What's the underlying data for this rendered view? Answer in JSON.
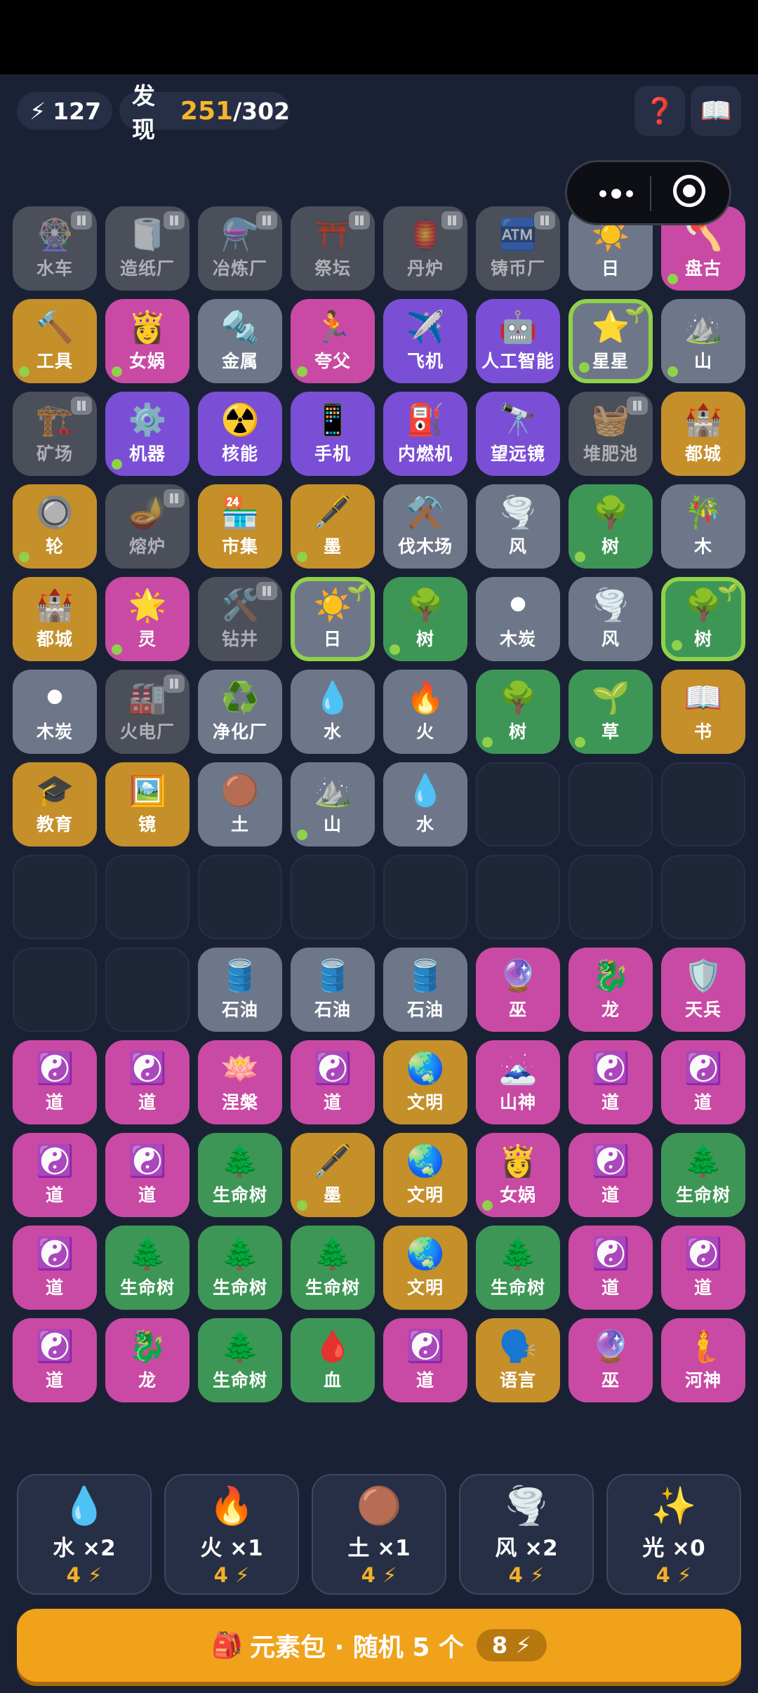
{
  "header": {
    "energy_icon": "⚡",
    "energy_value": "127",
    "discover_label": "发现",
    "discovered": "251",
    "total": "/302",
    "help_icon": "❓",
    "book_icon": "📖"
  },
  "colors": {
    "gray": "#6e7789",
    "gold": "#c58f2a",
    "pink": "#c94aa4",
    "purple": "#7a4fd5",
    "green": "#3e9656",
    "locked": "#4b4f59",
    "highlight": "#8fd14a",
    "accent": "#f7b52b"
  },
  "grid": [
    [
      {
        "e": "🎡",
        "n": "水车",
        "c": "locked"
      },
      {
        "e": "🧻",
        "n": "造纸厂",
        "c": "locked"
      },
      {
        "e": "⚗️",
        "n": "冶炼厂",
        "c": "locked"
      },
      {
        "e": "⛩️",
        "n": "祭坛",
        "c": "locked"
      },
      {
        "e": "🏮",
        "n": "丹炉",
        "c": "locked"
      },
      {
        "e": "🏧",
        "n": "铸币厂",
        "c": "locked"
      },
      {
        "e": "☀️",
        "n": "日",
        "c": "gray"
      },
      {
        "e": "🪓",
        "n": "盘古",
        "c": "pink",
        "dot": true
      }
    ],
    [
      {
        "e": "🔨",
        "n": "工具",
        "c": "gold",
        "dot": true
      },
      {
        "e": "👸",
        "n": "女娲",
        "c": "pink",
        "dot": true
      },
      {
        "e": "🔩",
        "n": "金属",
        "c": "gray"
      },
      {
        "e": "🏃",
        "n": "夸父",
        "c": "pink",
        "dot": true
      },
      {
        "e": "✈️",
        "n": "飞机",
        "c": "purple"
      },
      {
        "e": "🤖",
        "n": "人工智能",
        "c": "purple"
      },
      {
        "e": "⭐",
        "n": "星星",
        "c": "gray",
        "hl": true,
        "dot": true
      },
      {
        "e": "⛰️",
        "n": "山",
        "c": "gray",
        "dot": true
      }
    ],
    [
      {
        "e": "🏗️",
        "n": "矿场",
        "c": "locked"
      },
      {
        "e": "⚙️",
        "n": "机器",
        "c": "purple",
        "dot": true
      },
      {
        "e": "☢️",
        "n": "核能",
        "c": "purple"
      },
      {
        "e": "📱",
        "n": "手机",
        "c": "purple"
      },
      {
        "e": "⛽",
        "n": "内燃机",
        "c": "purple"
      },
      {
        "e": "🔭",
        "n": "望远镜",
        "c": "purple"
      },
      {
        "e": "🧺",
        "n": "堆肥池",
        "c": "locked"
      },
      {
        "e": "🏰",
        "n": "都城",
        "c": "gold"
      }
    ],
    [
      {
        "e": "🔘",
        "n": "轮",
        "c": "gold",
        "dot": true
      },
      {
        "e": "🪔",
        "n": "熔炉",
        "c": "locked"
      },
      {
        "e": "🏪",
        "n": "市集",
        "c": "gold"
      },
      {
        "e": "🖋️",
        "n": "墨",
        "c": "gold",
        "dot": true
      },
      {
        "e": "⚒️",
        "n": "伐木场",
        "c": "gray"
      },
      {
        "e": "🌪️",
        "n": "风",
        "c": "gray"
      },
      {
        "e": "🌳",
        "n": "树",
        "c": "green",
        "dot": true
      },
      {
        "e": "🎋",
        "n": "木",
        "c": "gray"
      }
    ],
    [
      {
        "e": "🏰",
        "n": "都城",
        "c": "gold"
      },
      {
        "e": "🌟",
        "n": "灵",
        "c": "pink",
        "dot": true
      },
      {
        "e": "🛠️",
        "n": "钻井",
        "c": "locked"
      },
      {
        "e": "☀️",
        "n": "日",
        "c": "gray",
        "hl": true
      },
      {
        "e": "🌳",
        "n": "树",
        "c": "green",
        "dot": true
      },
      {
        "e": "⚫",
        "n": "木炭",
        "c": "gray"
      },
      {
        "e": "🌪️",
        "n": "风",
        "c": "gray"
      },
      {
        "e": "🌳",
        "n": "树",
        "c": "green",
        "hl": true,
        "dot": true
      }
    ],
    [
      {
        "e": "⚫",
        "n": "木炭",
        "c": "gray"
      },
      {
        "e": "🏭",
        "n": "火电厂",
        "c": "locked"
      },
      {
        "e": "♻️",
        "n": "净化厂",
        "c": "gray"
      },
      {
        "e": "💧",
        "n": "水",
        "c": "gray"
      },
      {
        "e": "🔥",
        "n": "火",
        "c": "gray"
      },
      {
        "e": "🌳",
        "n": "树",
        "c": "green",
        "dot": true
      },
      {
        "e": "🌱",
        "n": "草",
        "c": "green",
        "dot": true
      },
      {
        "e": "📖",
        "n": "书",
        "c": "gold"
      }
    ],
    [
      {
        "e": "🎓",
        "n": "教育",
        "c": "gold"
      },
      {
        "e": "🖼️",
        "n": "镜",
        "c": "gold"
      },
      {
        "e": "🟤",
        "n": "土",
        "c": "gray"
      },
      {
        "e": "⛰️",
        "n": "山",
        "c": "gray",
        "dot": true
      },
      {
        "e": "💧",
        "n": "水",
        "c": "gray"
      },
      {
        "c": "empty"
      },
      {
        "c": "empty"
      },
      {
        "c": "empty"
      }
    ],
    [
      {
        "c": "empty"
      },
      {
        "c": "empty"
      },
      {
        "c": "empty"
      },
      {
        "c": "empty"
      },
      {
        "c": "empty"
      },
      {
        "c": "empty"
      },
      {
        "c": "empty"
      },
      {
        "c": "empty"
      }
    ],
    [
      {
        "c": "empty"
      },
      {
        "c": "empty"
      },
      {
        "e": "🛢️",
        "n": "石油",
        "c": "gray"
      },
      {
        "e": "🛢️",
        "n": "石油",
        "c": "gray"
      },
      {
        "e": "🛢️",
        "n": "石油",
        "c": "gray"
      },
      {
        "e": "🔮",
        "n": "巫",
        "c": "pink"
      },
      {
        "e": "🐉",
        "n": "龙",
        "c": "pink"
      },
      {
        "e": "🛡️",
        "n": "天兵",
        "c": "pink"
      }
    ],
    [
      {
        "e": "☯️",
        "n": "道",
        "c": "pink"
      },
      {
        "e": "☯️",
        "n": "道",
        "c": "pink"
      },
      {
        "e": "🪷",
        "n": "涅槃",
        "c": "pink"
      },
      {
        "e": "☯️",
        "n": "道",
        "c": "pink"
      },
      {
        "e": "🌏",
        "n": "文明",
        "c": "gold"
      },
      {
        "e": "🗻",
        "n": "山神",
        "c": "pink"
      },
      {
        "e": "☯️",
        "n": "道",
        "c": "pink"
      },
      {
        "e": "☯️",
        "n": "道",
        "c": "pink"
      }
    ],
    [
      {
        "e": "☯️",
        "n": "道",
        "c": "pink"
      },
      {
        "e": "☯️",
        "n": "道",
        "c": "pink"
      },
      {
        "e": "🌲",
        "n": "生命树",
        "c": "green"
      },
      {
        "e": "🖋️",
        "n": "墨",
        "c": "gold",
        "dot": true
      },
      {
        "e": "🌏",
        "n": "文明",
        "c": "gold"
      },
      {
        "e": "👸",
        "n": "女娲",
        "c": "pink",
        "dot": true
      },
      {
        "e": "☯️",
        "n": "道",
        "c": "pink"
      },
      {
        "e": "🌲",
        "n": "生命树",
        "c": "green"
      }
    ],
    [
      {
        "e": "☯️",
        "n": "道",
        "c": "pink"
      },
      {
        "e": "🌲",
        "n": "生命树",
        "c": "green"
      },
      {
        "e": "🌲",
        "n": "生命树",
        "c": "green"
      },
      {
        "e": "🌲",
        "n": "生命树",
        "c": "green"
      },
      {
        "e": "🌏",
        "n": "文明",
        "c": "gold"
      },
      {
        "e": "🌲",
        "n": "生命树",
        "c": "green"
      },
      {
        "e": "☯️",
        "n": "道",
        "c": "pink"
      },
      {
        "e": "☯️",
        "n": "道",
        "c": "pink"
      }
    ],
    [
      {
        "e": "☯️",
        "n": "道",
        "c": "pink"
      },
      {
        "e": "🐉",
        "n": "龙",
        "c": "pink"
      },
      {
        "e": "🌲",
        "n": "生命树",
        "c": "green"
      },
      {
        "e": "🩸",
        "n": "血",
        "c": "green"
      },
      {
        "e": "☯️",
        "n": "道",
        "c": "pink"
      },
      {
        "e": "🗣️",
        "n": "语言",
        "c": "gold"
      },
      {
        "e": "🔮",
        "n": "巫",
        "c": "pink"
      },
      {
        "e": "🧜",
        "n": "河神",
        "c": "pink"
      }
    ]
  ],
  "packs": [
    {
      "emoji": "💧",
      "name": "水 ×2",
      "cost": "4 ⚡"
    },
    {
      "emoji": "🔥",
      "name": "火 ×1",
      "cost": "4 ⚡"
    },
    {
      "emoji": "🟤",
      "name": "土 ×1",
      "cost": "4 ⚡"
    },
    {
      "emoji": "🌪️",
      "name": "风 ×2",
      "cost": "4 ⚡"
    },
    {
      "emoji": "✨",
      "name": "光 ×0",
      "cost": "4 ⚡"
    }
  ],
  "buy_button": {
    "icon": "🎒",
    "label": "元素包 · 随机 5 个",
    "cost": "8 ⚡"
  }
}
